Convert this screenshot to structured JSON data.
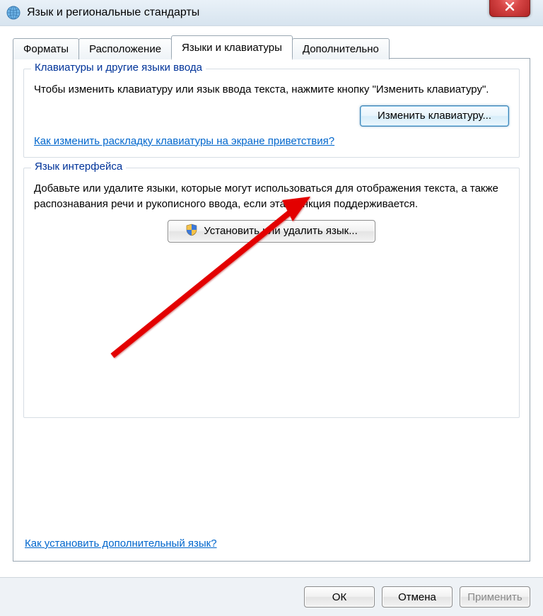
{
  "window": {
    "title": "Язык и региональные стандарты"
  },
  "tabs": {
    "formats": "Форматы",
    "location": "Расположение",
    "keyboards": "Языки и клавиатуры",
    "advanced": "Дополнительно"
  },
  "group_keyboards": {
    "legend": "Клавиатуры и другие языки ввода",
    "text": "Чтобы изменить клавиатуру или язык ввода текста, нажмите кнопку \"Изменить клавиатуру\".",
    "button": "Изменить клавиатуру...",
    "link": "Как изменить раскладку клавиатуры на экране приветствия?"
  },
  "group_display": {
    "legend": "Язык интерфейса",
    "text": "Добавьте или удалите языки, которые могут использоваться для отображения текста, а также распознавания речи и рукописного ввода, если эта функция поддерживается.",
    "button": "Установить или удалить язык..."
  },
  "bottom_link": "Как установить дополнительный язык?",
  "footer": {
    "ok": "ОК",
    "cancel": "Отмена",
    "apply": "Применить"
  }
}
